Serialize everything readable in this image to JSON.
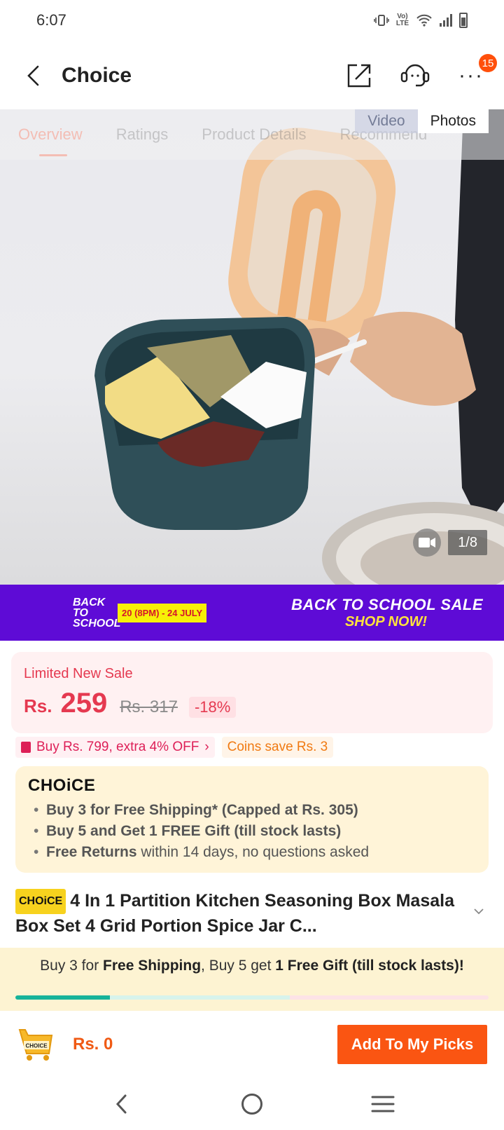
{
  "status": {
    "time": "6:07",
    "network": "LTE"
  },
  "header": {
    "title": "Choice",
    "notification_count": "15"
  },
  "tabs": [
    {
      "label": "Overview"
    },
    {
      "label": "Ratings"
    },
    {
      "label": "Product Details"
    },
    {
      "label": "Recommend"
    }
  ],
  "media": {
    "video_label": "Video",
    "photos_label": "Photos",
    "counter": "1/8"
  },
  "banner": {
    "logo_text": "BACK TO SCHOOL",
    "date_range": "20 (8PM) - 24 JULY",
    "title": "BACK TO SCHOOL SALE",
    "cta": "SHOP NOW!"
  },
  "price": {
    "sale_label": "Limited New Sale",
    "currency": "Rs.",
    "current": "259",
    "original": "Rs. 317",
    "discount": "-18%"
  },
  "offers": {
    "store_offer": "Buy Rs. 799, extra 4% OFF",
    "coins": "Coins save Rs. 3"
  },
  "choice": {
    "logo": "CHOiCE",
    "benefits": [
      {
        "bold": "Buy 3 for  Free Shipping* (Capped at Rs. 305)",
        "rest": ""
      },
      {
        "bold": "Buy 5 and Get 1 FREE Gift (till stock lasts)",
        "rest": ""
      },
      {
        "bold": "Free Returns",
        "rest": " within 14 days, no questions asked"
      }
    ]
  },
  "product": {
    "badge": "CHOiCE",
    "title": "4 In 1 Partition Kitchen Seasoning Box Masala Box Set 4 Grid Portion Spice Jar C..."
  },
  "shipping_strip": {
    "part1": "Buy 3 for ",
    "bold1": "Free Shipping",
    "part2": ", Buy 5 get ",
    "bold2": "1 Free Gift (till stock lasts)!",
    "progress_fraction": 0.2
  },
  "bottom": {
    "cart_label": "CHOICE",
    "cart_amount": "Rs. 0",
    "add_button": "Add To My Picks"
  },
  "colors": {
    "accent": "#fa5512",
    "price": "#e53950",
    "banner": "#5e0bd6"
  }
}
